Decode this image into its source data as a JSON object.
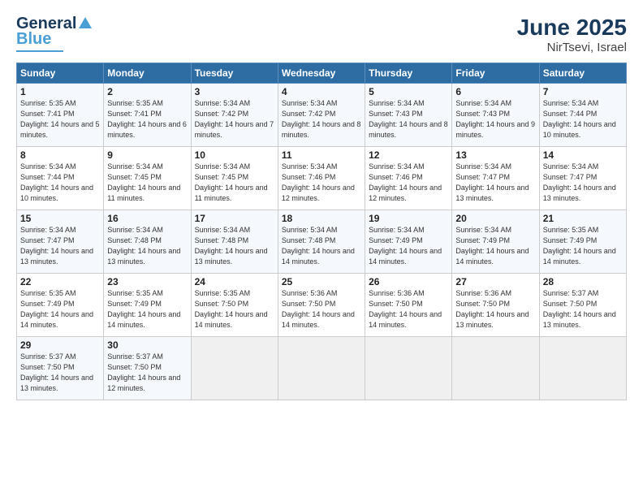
{
  "logo": {
    "line1": "General",
    "line2": "Blue"
  },
  "title": "June 2025",
  "location": "NirTsevi, Israel",
  "days_of_week": [
    "Sunday",
    "Monday",
    "Tuesday",
    "Wednesday",
    "Thursday",
    "Friday",
    "Saturday"
  ],
  "weeks": [
    [
      {
        "day": "1",
        "sunrise": "5:35 AM",
        "sunset": "7:41 PM",
        "daylight": "14 hours and 5 minutes."
      },
      {
        "day": "2",
        "sunrise": "5:35 AM",
        "sunset": "7:41 PM",
        "daylight": "14 hours and 6 minutes."
      },
      {
        "day": "3",
        "sunrise": "5:34 AM",
        "sunset": "7:42 PM",
        "daylight": "14 hours and 7 minutes."
      },
      {
        "day": "4",
        "sunrise": "5:34 AM",
        "sunset": "7:42 PM",
        "daylight": "14 hours and 8 minutes."
      },
      {
        "day": "5",
        "sunrise": "5:34 AM",
        "sunset": "7:43 PM",
        "daylight": "14 hours and 8 minutes."
      },
      {
        "day": "6",
        "sunrise": "5:34 AM",
        "sunset": "7:43 PM",
        "daylight": "14 hours and 9 minutes."
      },
      {
        "day": "7",
        "sunrise": "5:34 AM",
        "sunset": "7:44 PM",
        "daylight": "14 hours and 10 minutes."
      }
    ],
    [
      {
        "day": "8",
        "sunrise": "5:34 AM",
        "sunset": "7:44 PM",
        "daylight": "14 hours and 10 minutes."
      },
      {
        "day": "9",
        "sunrise": "5:34 AM",
        "sunset": "7:45 PM",
        "daylight": "14 hours and 11 minutes."
      },
      {
        "day": "10",
        "sunrise": "5:34 AM",
        "sunset": "7:45 PM",
        "daylight": "14 hours and 11 minutes."
      },
      {
        "day": "11",
        "sunrise": "5:34 AM",
        "sunset": "7:46 PM",
        "daylight": "14 hours and 12 minutes."
      },
      {
        "day": "12",
        "sunrise": "5:34 AM",
        "sunset": "7:46 PM",
        "daylight": "14 hours and 12 minutes."
      },
      {
        "day": "13",
        "sunrise": "5:34 AM",
        "sunset": "7:47 PM",
        "daylight": "14 hours and 13 minutes."
      },
      {
        "day": "14",
        "sunrise": "5:34 AM",
        "sunset": "7:47 PM",
        "daylight": "14 hours and 13 minutes."
      }
    ],
    [
      {
        "day": "15",
        "sunrise": "5:34 AM",
        "sunset": "7:47 PM",
        "daylight": "14 hours and 13 minutes."
      },
      {
        "day": "16",
        "sunrise": "5:34 AM",
        "sunset": "7:48 PM",
        "daylight": "14 hours and 13 minutes."
      },
      {
        "day": "17",
        "sunrise": "5:34 AM",
        "sunset": "7:48 PM",
        "daylight": "14 hours and 13 minutes."
      },
      {
        "day": "18",
        "sunrise": "5:34 AM",
        "sunset": "7:48 PM",
        "daylight": "14 hours and 14 minutes."
      },
      {
        "day": "19",
        "sunrise": "5:34 AM",
        "sunset": "7:49 PM",
        "daylight": "14 hours and 14 minutes."
      },
      {
        "day": "20",
        "sunrise": "5:34 AM",
        "sunset": "7:49 PM",
        "daylight": "14 hours and 14 minutes."
      },
      {
        "day": "21",
        "sunrise": "5:35 AM",
        "sunset": "7:49 PM",
        "daylight": "14 hours and 14 minutes."
      }
    ],
    [
      {
        "day": "22",
        "sunrise": "5:35 AM",
        "sunset": "7:49 PM",
        "daylight": "14 hours and 14 minutes."
      },
      {
        "day": "23",
        "sunrise": "5:35 AM",
        "sunset": "7:49 PM",
        "daylight": "14 hours and 14 minutes."
      },
      {
        "day": "24",
        "sunrise": "5:35 AM",
        "sunset": "7:50 PM",
        "daylight": "14 hours and 14 minutes."
      },
      {
        "day": "25",
        "sunrise": "5:36 AM",
        "sunset": "7:50 PM",
        "daylight": "14 hours and 14 minutes."
      },
      {
        "day": "26",
        "sunrise": "5:36 AM",
        "sunset": "7:50 PM",
        "daylight": "14 hours and 14 minutes."
      },
      {
        "day": "27",
        "sunrise": "5:36 AM",
        "sunset": "7:50 PM",
        "daylight": "14 hours and 13 minutes."
      },
      {
        "day": "28",
        "sunrise": "5:37 AM",
        "sunset": "7:50 PM",
        "daylight": "14 hours and 13 minutes."
      }
    ],
    [
      {
        "day": "29",
        "sunrise": "5:37 AM",
        "sunset": "7:50 PM",
        "daylight": "14 hours and 13 minutes."
      },
      {
        "day": "30",
        "sunrise": "5:37 AM",
        "sunset": "7:50 PM",
        "daylight": "14 hours and 12 minutes."
      },
      null,
      null,
      null,
      null,
      null
    ]
  ]
}
